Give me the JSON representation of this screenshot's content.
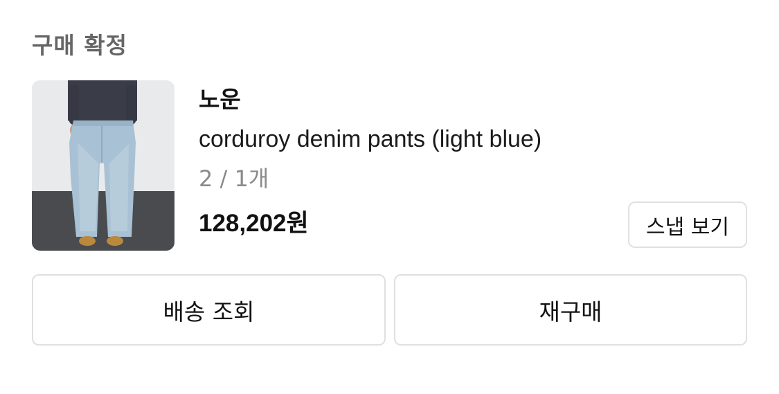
{
  "order": {
    "status": "구매 확정"
  },
  "product": {
    "brand": "노운",
    "name": "corduroy denim pants (light blue)",
    "option": "2 / 1개",
    "price": "128,202원",
    "image_icon": "product-photo"
  },
  "actions": {
    "snap_label": "스냅 보기",
    "delivery_label": "배송 조회",
    "rebuy_label": "재구매"
  },
  "colors": {
    "status_text": "#666666",
    "button_border": "#e0e0e0",
    "option_text": "#8a8a8a"
  }
}
